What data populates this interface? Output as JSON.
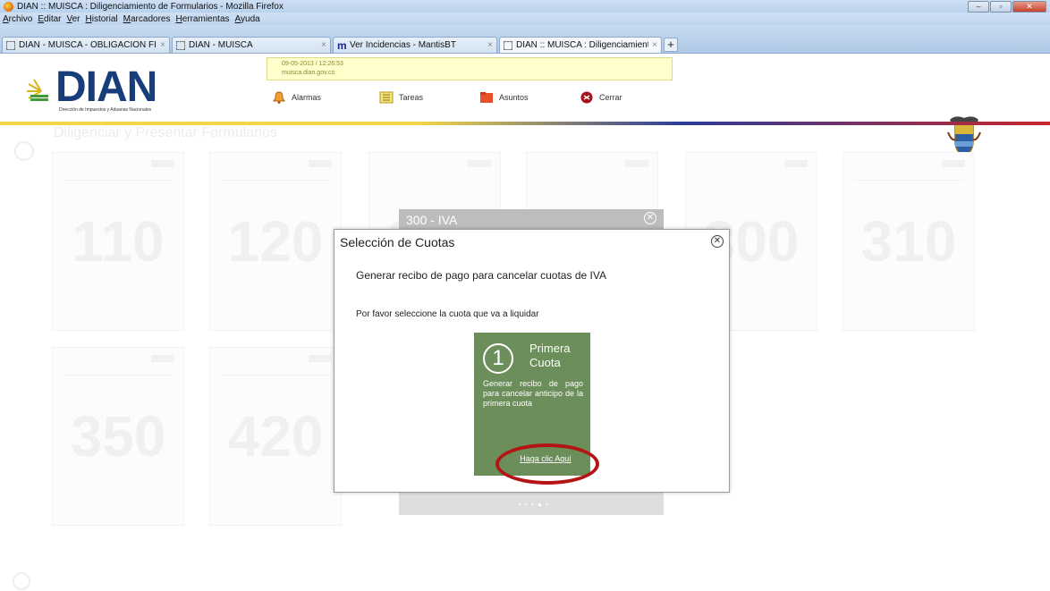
{
  "window": {
    "title": "DIAN :: MUISCA : Diligenciamiento de Formularios - Mozilla Firefox"
  },
  "menu": [
    "Archivo",
    "Editar",
    "Ver",
    "Historial",
    "Marcadores",
    "Herramientas",
    "Ayuda"
  ],
  "tabs": [
    {
      "label": "DIAN - MUISCA - OBLIGACION FINA...",
      "active": false
    },
    {
      "label": "DIAN - MUISCA",
      "active": false
    },
    {
      "label": "Ver Incidencias - MantisBT",
      "active": false
    },
    {
      "label": "DIAN :: MUISCA : Diligenciamiento d...",
      "active": true
    }
  ],
  "header": {
    "logo_text": "DIAN",
    "logo_subtitle": "Dirección de Impuestos y Aduanas Nacionales",
    "datetime": "09-05-2013 / 12:26:53",
    "domain": "muisca.dian.gov.co",
    "nav": [
      {
        "label": "Alarmas",
        "icon": "bell-icon"
      },
      {
        "label": "Tareas",
        "icon": "tasks-icon"
      },
      {
        "label": "Asuntos",
        "icon": "folder-icon"
      },
      {
        "label": "Cerrar",
        "icon": "close-session-icon"
      }
    ]
  },
  "background": {
    "heading": "Diligenciar y Presentar Formularios",
    "forms": [
      "110",
      "120",
      "300",
      "350",
      "420",
      "300",
      "310"
    ],
    "underlying_modal_title": "300 - IVA"
  },
  "dialog": {
    "title": "Selección de Cuotas",
    "subtitle": "Generar recibo de pago para cancelar cuotas de IVA",
    "prompt": "Por favor seleccione la cuota que va a liquidar",
    "tile": {
      "number": "1",
      "title_line1": "Primera",
      "title_line2": "Cuota",
      "description": "Generar recibo de pago para cancelar anticipo de la primera cuota",
      "link": "Haga clic Aquí",
      "color": "#6b8e5a"
    }
  },
  "colors": {
    "highlight": "#b41414",
    "brand_blue": "#173e7a"
  }
}
